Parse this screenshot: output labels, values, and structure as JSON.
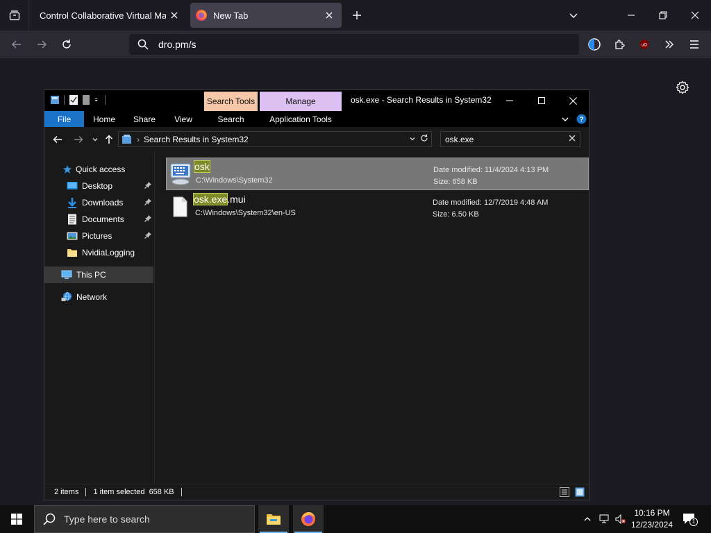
{
  "browser": {
    "tabs": [
      {
        "title": "Control Collaborative Virtual Machi"
      },
      {
        "title": "New Tab"
      }
    ],
    "url": "dro.pm/s"
  },
  "explorer": {
    "title": "osk.exe - Search Results in System32",
    "context_tabs": {
      "search_tools": "Search Tools",
      "manage": "Manage"
    },
    "ribbon_tabs": [
      "File",
      "Home",
      "Share",
      "View",
      "Search",
      "Application Tools"
    ],
    "address": "Search Results in System32",
    "search_value": "osk.exe",
    "nav_items": [
      {
        "label": "Quick access",
        "icon": "star-icon"
      },
      {
        "label": "Desktop",
        "icon": "desktop-icon",
        "pinned": true
      },
      {
        "label": "Downloads",
        "icon": "downloads-icon",
        "pinned": true
      },
      {
        "label": "Documents",
        "icon": "documents-icon",
        "pinned": true
      },
      {
        "label": "Pictures",
        "icon": "pictures-icon",
        "pinned": true
      },
      {
        "label": "NvidiaLogging",
        "icon": "folder-icon"
      },
      {
        "label": "This PC",
        "icon": "pc-icon",
        "selected": true
      },
      {
        "label": "Network",
        "icon": "network-icon"
      }
    ],
    "results": [
      {
        "name_match": "osk",
        "name_rest": "",
        "path": "C:\\Windows\\System32",
        "date_label": "Date modified:",
        "date": "11/4/2024 4:13 PM",
        "size_label": "Size:",
        "size": "658 KB",
        "selected": true
      },
      {
        "name_match": "osk.exe",
        "name_rest": ".mui",
        "path": "C:\\Windows\\System32\\en-US",
        "date_label": "Date modified:",
        "date": "12/7/2019 4:48 AM",
        "size_label": "Size:",
        "size": "6.50 KB",
        "selected": false
      }
    ],
    "status": {
      "items": "2 items",
      "selected": "1 item selected  658 KB"
    }
  },
  "taskbar": {
    "search_placeholder": "Type here to search",
    "time": "10:16 PM",
    "date": "12/23/2024",
    "notification_count": "1"
  }
}
